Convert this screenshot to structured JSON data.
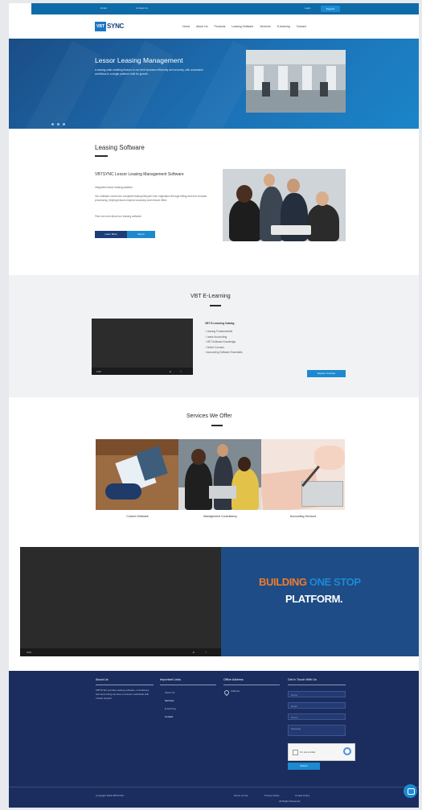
{
  "topbar": {
    "left_items": [
      "Email",
      "Contact Us"
    ],
    "right_link": "Login",
    "button": "Support"
  },
  "header": {
    "logo_box": "VBT",
    "logo_text": "SYNC",
    "nav": [
      "Home",
      "About Us",
      "Products",
      "Leasing Software",
      "Services",
      "E-learning",
      "Contact"
    ]
  },
  "hero": {
    "title": "Lessor Leasing Management",
    "text": "A leasing suite enabling lessors to run their business efficiently and securely, with automated workflows in a single platform built for growth."
  },
  "leasing": {
    "title": "Leasing Software",
    "heading": "VBTSYNC Lessor Leasing Management Software",
    "subheading": "Integrated lessor leasing platform",
    "paragraph": "Our software covers the complete leasing lifecycle from origination through billing and end-of-lease processing, helping lessors improve accuracy and reduce effort.",
    "note": "Find out more about our leasing software",
    "btn_primary": "Learn More",
    "btn_secondary": "Demo"
  },
  "vbt": {
    "title": "VBT E-Learning",
    "video_time": "0:00",
    "list_heading": "VBT E-Learning Catalog",
    "list": [
      "Leasing Fundamentals",
      "Lease Accounting",
      "VBT Software Knowledge",
      "Online Courses",
      "Accounting Software Essentials"
    ],
    "button": "Explore Courses"
  },
  "services": {
    "title": "Services We Offer",
    "items": [
      "Custom Software",
      "Management Consultancy",
      "Accounting Services"
    ]
  },
  "promo": {
    "video_time": "0:00",
    "word_building": "BUILDING",
    "word_onestop": "ONE STOP",
    "word_platform": "PLATFORM."
  },
  "footer": {
    "about_heading": "About Us",
    "about_text": "VBTSYNC provides leasing software, consultancy and accounting services to lessors worldwide with trusted support.",
    "links_heading": "Important Links",
    "links": [
      "About Us",
      "Services",
      "E-learning",
      "Contact"
    ],
    "contact_heading": "Office Address",
    "contact_text": "Address",
    "form_heading": "Get In Touch With Us",
    "fields": [
      "Name",
      "Email",
      "Phone",
      "Message"
    ],
    "captcha_label": "I'm not a robot",
    "submit": "Submit",
    "copyright": "Copyright 2023 VBTSYNC",
    "legal": [
      "Terms of Use",
      "Privacy Policy",
      "Cookie Policy"
    ],
    "legal_sub": "All Rights Reserved"
  },
  "colors": {
    "brand_blue": "#1d8ad0",
    "navy": "#1a2d5e",
    "accent_orange": "#f07c2a"
  }
}
